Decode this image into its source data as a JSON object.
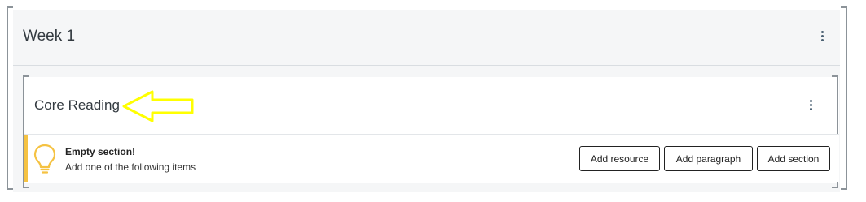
{
  "week": {
    "title": "Week 1"
  },
  "section": {
    "title": "Core Reading"
  },
  "empty_state": {
    "title": "Empty section!",
    "subtitle": "Add one of the following items",
    "accent_color": "#f5c242",
    "icon": "lightbulb-icon"
  },
  "actions": {
    "add_resource": "Add resource",
    "add_paragraph": "Add paragraph",
    "add_section": "Add section"
  },
  "annotation": {
    "icon": "arrow-left-icon",
    "color": "#ffff00"
  }
}
